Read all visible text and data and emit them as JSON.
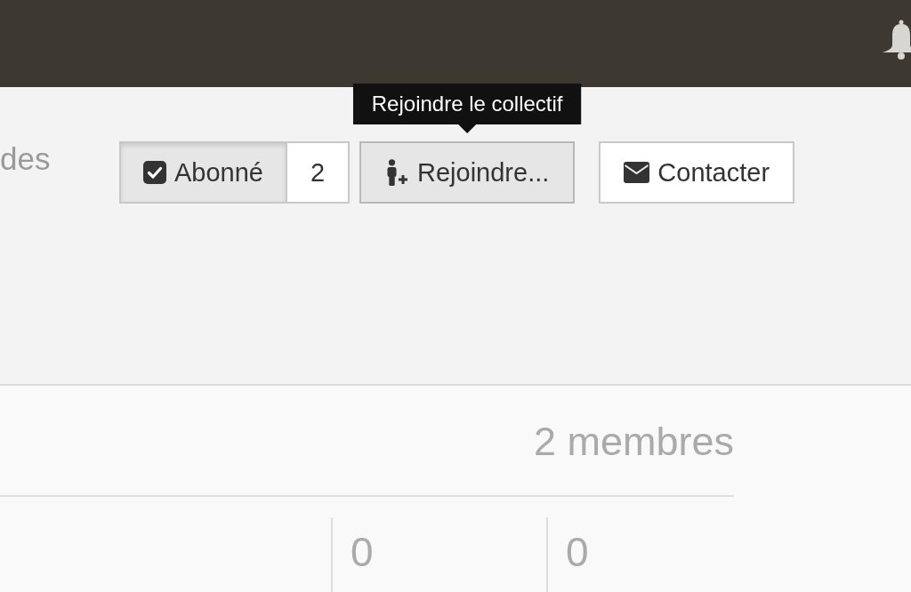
{
  "profile": {
    "intro_text": "des"
  },
  "actions": {
    "subscribe": {
      "label": "Abonné",
      "checked": true,
      "count": "2"
    },
    "join": {
      "label": "Rejoindre...",
      "hovered": true,
      "tooltip": "Rejoindre le collectif"
    },
    "contact": {
      "label": "Contacter"
    }
  },
  "stats": {
    "members": "2 membres",
    "columns": [
      {
        "value": "0"
      },
      {
        "value": "0"
      }
    ]
  }
}
